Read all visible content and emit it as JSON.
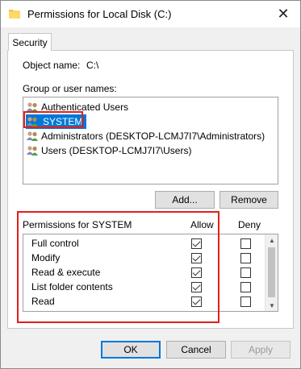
{
  "window": {
    "title": "Permissions for Local Disk (C:)"
  },
  "tabs": [
    {
      "label": "Security"
    }
  ],
  "object": {
    "label": "Object name:",
    "value": "C:\\"
  },
  "group_label": "Group or user names:",
  "users": [
    {
      "label": "Authenticated Users",
      "selected": false
    },
    {
      "label": "SYSTEM",
      "selected": true
    },
    {
      "label": "Administrators (DESKTOP-LCMJ7I7\\Administrators)",
      "selected": false
    },
    {
      "label": "Users (DESKTOP-LCMJ7I7\\Users)",
      "selected": false
    }
  ],
  "buttons": {
    "add_label": "Add...",
    "remove_label": "Remove",
    "ok_label": "OK",
    "cancel_label": "Cancel",
    "apply_label": "Apply"
  },
  "permissions": {
    "header": "Permissions for SYSTEM",
    "allow_header": "Allow",
    "deny_header": "Deny",
    "rows": [
      {
        "name": "Full control",
        "allow": true,
        "deny": false
      },
      {
        "name": "Modify",
        "allow": true,
        "deny": false
      },
      {
        "name": "Read & execute",
        "allow": true,
        "deny": false
      },
      {
        "name": "List folder contents",
        "allow": true,
        "deny": false
      },
      {
        "name": "Read",
        "allow": true,
        "deny": false
      }
    ]
  },
  "colors": {
    "selection": "#0078d7",
    "highlight_outline": "#e0201a"
  }
}
